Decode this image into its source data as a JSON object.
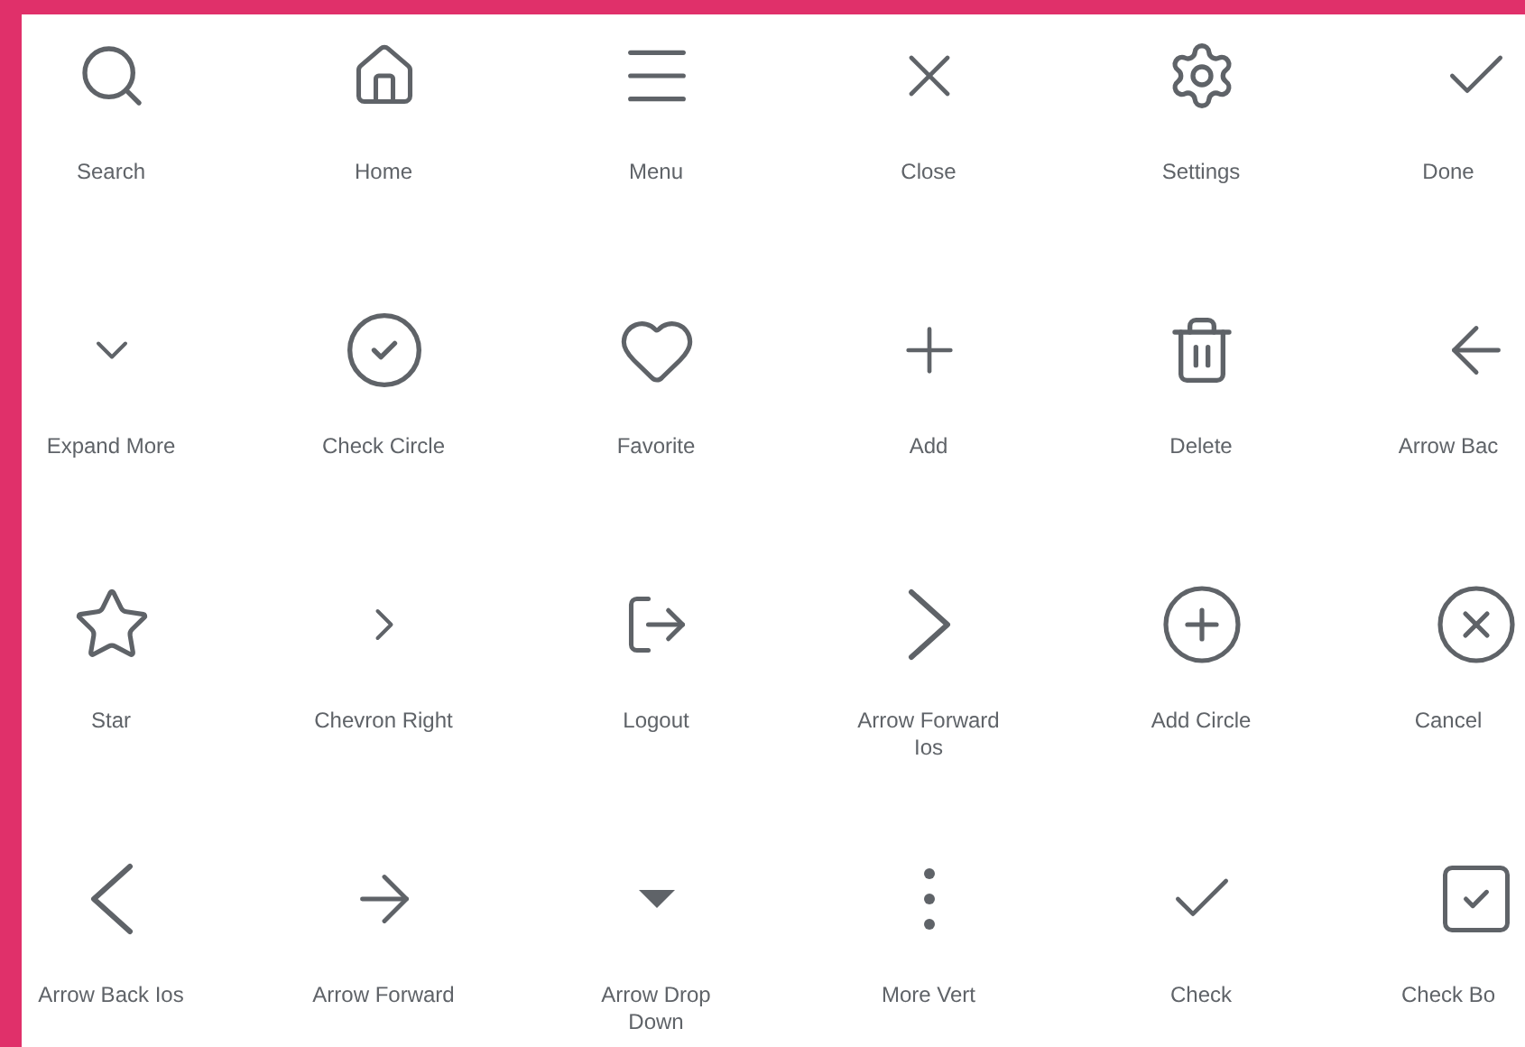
{
  "icons": [
    {
      "kind": "search",
      "label": "Search"
    },
    {
      "kind": "home",
      "label": "Home"
    },
    {
      "kind": "menu",
      "label": "Menu"
    },
    {
      "kind": "close",
      "label": "Close"
    },
    {
      "kind": "settings",
      "label": "Settings"
    },
    {
      "kind": "done",
      "label": "Done"
    },
    {
      "kind": "expand",
      "label": "Expand More"
    },
    {
      "kind": "checkcircle",
      "label": "Check Circle"
    },
    {
      "kind": "heart",
      "label": "Favorite"
    },
    {
      "kind": "add",
      "label": "Add"
    },
    {
      "kind": "delete",
      "label": "Delete"
    },
    {
      "kind": "arrowback",
      "label": "Arrow Bac"
    },
    {
      "kind": "star",
      "label": "Star"
    },
    {
      "kind": "chevronright",
      "label": "Chevron Right"
    },
    {
      "kind": "logout",
      "label": "Logout"
    },
    {
      "kind": "forwardios",
      "label": "Arrow Forward Ios"
    },
    {
      "kind": "addcircle",
      "label": "Add Circle"
    },
    {
      "kind": "cancel",
      "label": "Cancel"
    },
    {
      "kind": "backios",
      "label": "Arrow Back Ios"
    },
    {
      "kind": "arrowforward",
      "label": "Arrow Forward"
    },
    {
      "kind": "dropdown",
      "label": "Arrow Drop Down"
    },
    {
      "kind": "morevert",
      "label": "More Vert"
    },
    {
      "kind": "check",
      "label": "Check"
    },
    {
      "kind": "checkbox",
      "label": "Check Bo"
    }
  ]
}
